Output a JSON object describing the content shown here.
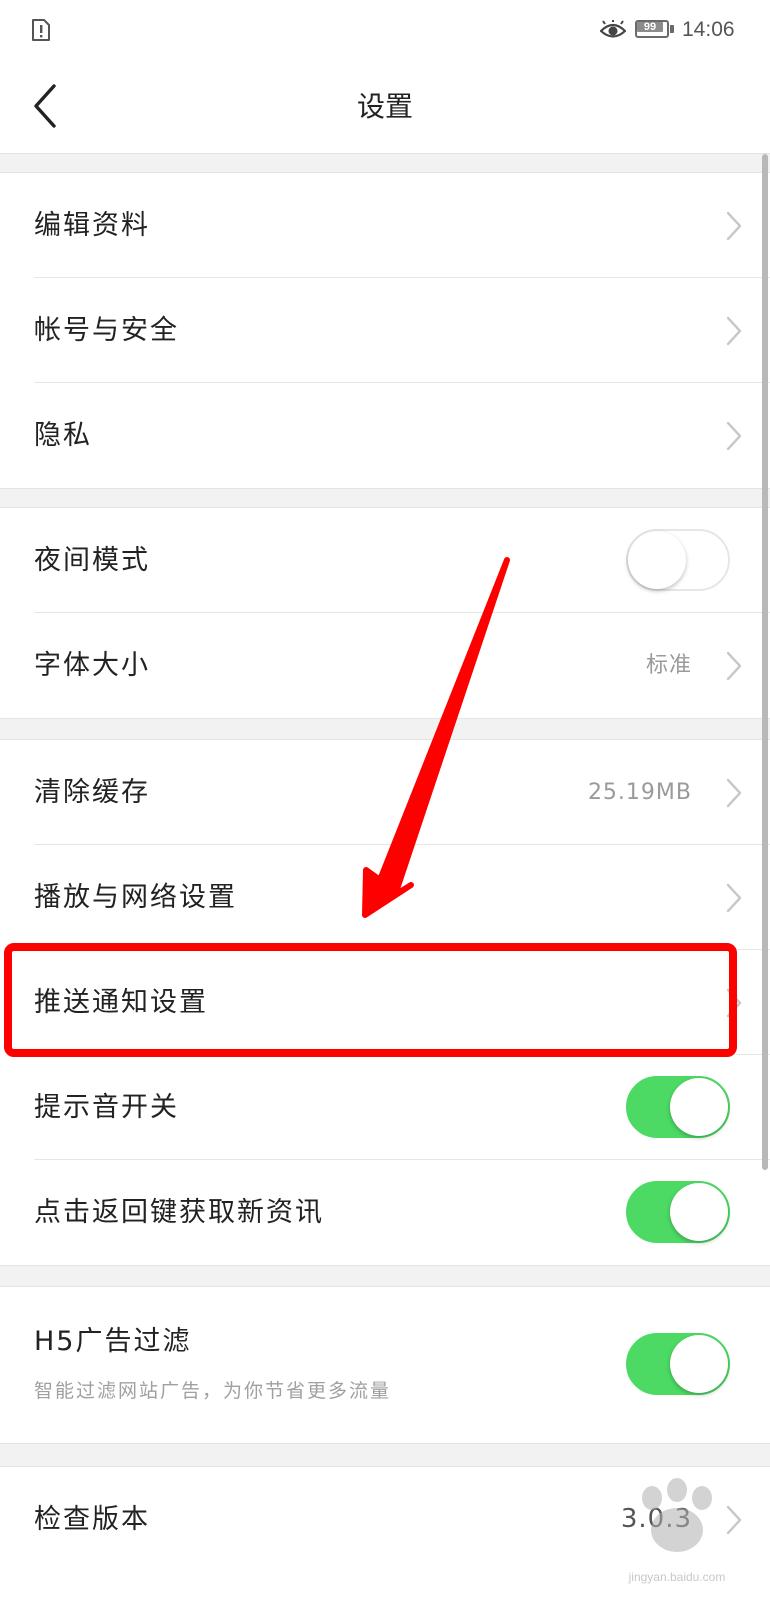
{
  "status_bar": {
    "battery_level": "99",
    "time": "14:06",
    "icons": [
      "sim-alert-icon",
      "eye-icon",
      "battery-icon"
    ]
  },
  "header": {
    "title": "设置",
    "back_icon": "chevron-left-icon"
  },
  "groups": [
    {
      "rows": [
        {
          "label": "编辑资料",
          "control": "chevron"
        },
        {
          "label": "帐号与安全",
          "control": "chevron"
        },
        {
          "label": "隐私",
          "control": "chevron"
        }
      ]
    },
    {
      "rows": [
        {
          "label": "夜间模式",
          "control": "toggle",
          "state": "off"
        },
        {
          "label": "字体大小",
          "value": "标准",
          "control": "chevron"
        }
      ]
    },
    {
      "rows": [
        {
          "label": "清除缓存",
          "value": "25.19MB",
          "control": "chevron"
        },
        {
          "label": "播放与网络设置",
          "control": "chevron"
        },
        {
          "label": "推送通知设置",
          "control": "chevron",
          "highlighted": true
        },
        {
          "label": "提示音开关",
          "control": "toggle",
          "state": "on"
        },
        {
          "label": "点击返回键获取新资讯",
          "control": "toggle",
          "state": "on"
        }
      ]
    },
    {
      "rows": [
        {
          "label": "H5广告过滤",
          "subtitle": "智能过滤网站广告，为你节省更多流量",
          "control": "toggle",
          "state": "on"
        }
      ]
    },
    {
      "rows": [
        {
          "label": "检查版本",
          "value": "3.0.3",
          "control": "chevron"
        }
      ]
    }
  ],
  "annotation": {
    "highlight_color": "#ff0000",
    "arrow_color": "#ff0000",
    "watermark_text": "jingyan.baidu.com"
  },
  "colors": {
    "toggle_on": "#4cd964",
    "background": "#f2f2f2",
    "row_background": "#ffffff",
    "secondary_text": "#9a9a9a"
  }
}
